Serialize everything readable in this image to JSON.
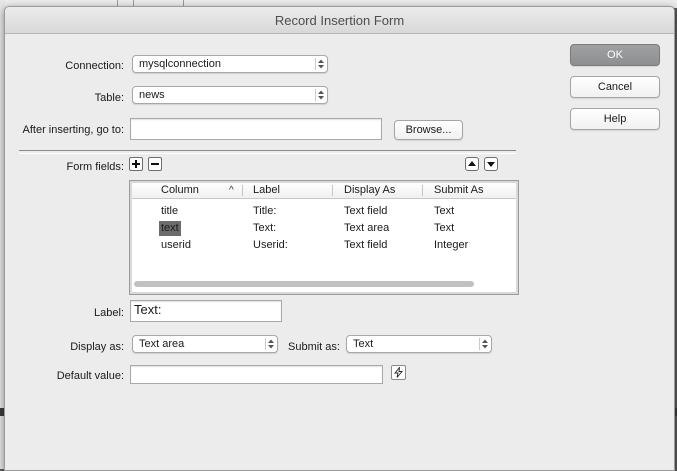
{
  "dialog": {
    "title": "Record Insertion Form",
    "buttons": {
      "ok": "OK",
      "cancel": "Cancel",
      "help": "Help"
    }
  },
  "connection": {
    "label": "Connection:",
    "value": "mysqlconnection"
  },
  "table": {
    "label": "Table:",
    "value": "news"
  },
  "after_inserting": {
    "label": "After inserting, go to:",
    "value": "",
    "browse_label": "Browse..."
  },
  "form_fields": {
    "label": "Form fields:",
    "columns": [
      "Column",
      "Label",
      "Display As",
      "Submit As"
    ],
    "sort_indicator": "^",
    "rows": [
      {
        "column": "title",
        "label": "Title:",
        "display_as": "Text field",
        "submit_as": "Text"
      },
      {
        "column": "text",
        "label": "Text:",
        "display_as": "Text area",
        "submit_as": "Text",
        "selected": true
      },
      {
        "column": "userid",
        "label": "Userid:",
        "display_as": "Text field",
        "submit_as": "Integer"
      }
    ]
  },
  "field_label": {
    "label": "Label:",
    "value": "Text:"
  },
  "display_as": {
    "label": "Display as:",
    "value": "Text area"
  },
  "submit_as": {
    "label": "Submit as:",
    "value": "Text"
  },
  "default_value": {
    "label": "Default value:",
    "value": ""
  },
  "icons": {
    "add": "plus-icon",
    "remove": "minus-icon",
    "move_up": "arrow-up-icon",
    "move_down": "arrow-down-icon",
    "dynamic_data": "lightning-bolt-icon",
    "popup": "stepper-icon"
  },
  "colors": {
    "default_button": "#8e8f91",
    "selected_row": "#6c6c6c",
    "dialog_bg": "#ececec"
  }
}
